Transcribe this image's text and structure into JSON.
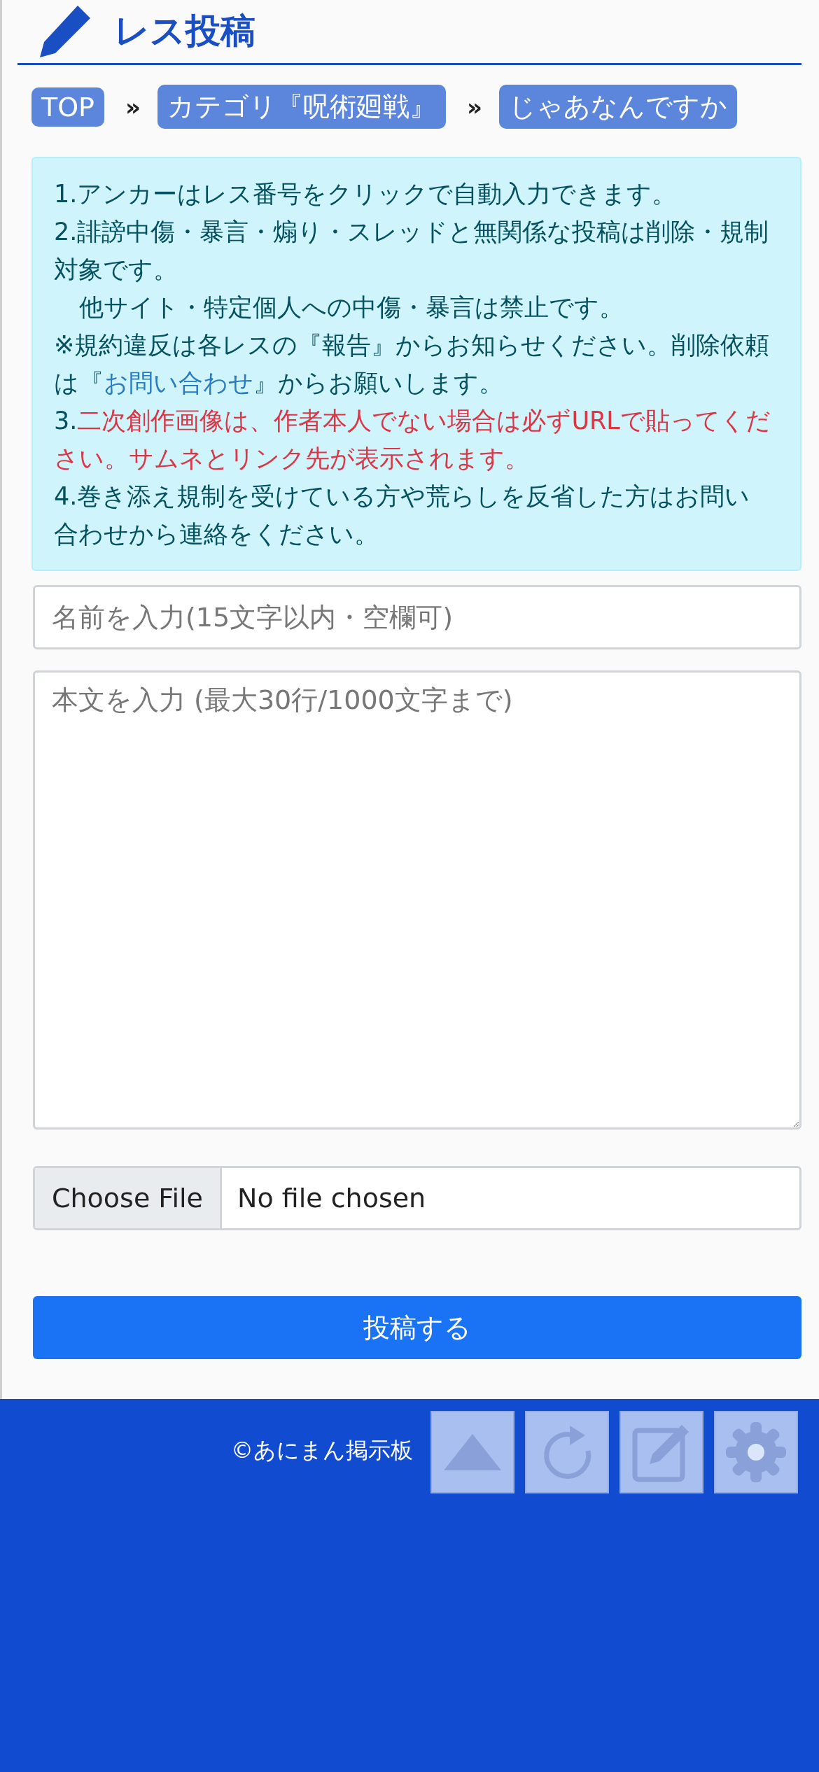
{
  "header": {
    "title": "レス投稿"
  },
  "breadcrumb": [
    {
      "kind": "link",
      "label": "TOP"
    },
    {
      "kind": "separator",
      "label": "»"
    },
    {
      "kind": "link",
      "label": "カテゴリ『呪術廻戦』"
    },
    {
      "kind": "separator",
      "label": "»"
    },
    {
      "kind": "link",
      "label": "じゃあなんですか"
    }
  ],
  "notice": [
    {
      "indented": false,
      "segments": [
        {
          "kind": "plain",
          "text": "1.アンカーはレス番号をクリックで自動入力できます。"
        }
      ]
    },
    {
      "indented": false,
      "segments": [
        {
          "kind": "plain",
          "text": "2.誹謗中傷・暴言・煽り・スレッドと無関係な投稿は削除・規制対象です。"
        }
      ]
    },
    {
      "indented": true,
      "segments": [
        {
          "kind": "plain",
          "text": "他サイト・特定個人への中傷・暴言は禁止です。"
        }
      ]
    },
    {
      "indented": false,
      "segments": [
        {
          "kind": "plain",
          "text": "※規約違反は各レスの『報告』からお知らせください。削除依頼は『"
        },
        {
          "kind": "link",
          "text": "お問い合わせ"
        },
        {
          "kind": "plain",
          "text": "』からお願いします。"
        }
      ]
    },
    {
      "indented": false,
      "segments": [
        {
          "kind": "plain",
          "text": "3."
        },
        {
          "kind": "warning",
          "text": "二次創作画像は、作者本人でない場合は必ずURLで貼ってください。サムネとリンク先が表示されます。"
        }
      ]
    },
    {
      "indented": false,
      "segments": [
        {
          "kind": "plain",
          "text": "4.巻き添え規制を受けている方や荒らしを反省した方はお問い合わせから連絡をください。"
        }
      ]
    }
  ],
  "form": {
    "name_field": {
      "placeholder": "名前を入力(15文字以内・空欄可)"
    },
    "body_field": {
      "placeholder": "本文を入力 (最大30行/1000文字まで)"
    },
    "file_field": {
      "button": "Choose File",
      "status": "No file chosen"
    },
    "submit": "投稿する"
  },
  "footer": {
    "copyright": "©あにまん掲示板"
  },
  "floating_buttons": [
    {
      "kind": "top"
    },
    {
      "kind": "reload"
    },
    {
      "kind": "edit"
    },
    {
      "kind": "settings"
    }
  ]
}
